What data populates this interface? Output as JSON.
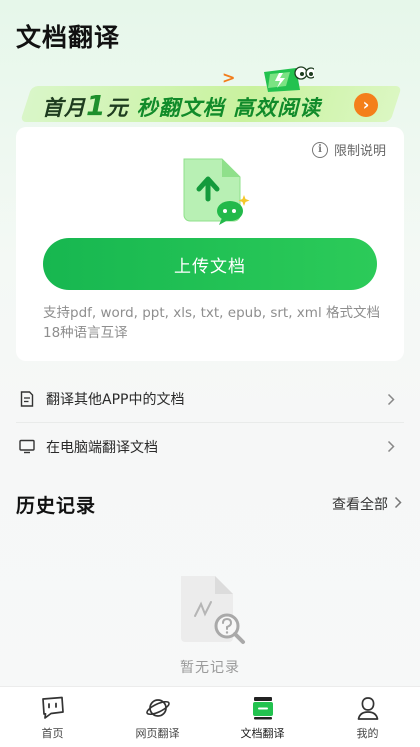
{
  "header": {
    "title": "文档翻译"
  },
  "banner": {
    "part1": "首月",
    "highlight_number": "1",
    "part2": "元",
    "part3": "秒翻文档",
    "part4": "高效阅读",
    "arrow": "›",
    "spark": ">"
  },
  "upload_card": {
    "limit_label": "限制说明",
    "info_glyph": "i",
    "upload_button_label": "上传文档",
    "support_text": "支持pdf, word, ppt, xls, txt, epub, srt, xml 格式文档 18种语言互译"
  },
  "options": [
    {
      "label": "翻译其他APP中的文档",
      "icon": "document-icon"
    },
    {
      "label": "在电脑端翻译文档",
      "icon": "monitor-icon"
    }
  ],
  "history": {
    "title": "历史记录",
    "view_all_label": "查看全部",
    "empty_text": "暂无记录"
  },
  "bottom_nav": {
    "items": [
      {
        "label": "首页",
        "icon": "home-chat-icon",
        "active": false
      },
      {
        "label": "网页翻译",
        "icon": "planet-icon",
        "active": false
      },
      {
        "label": "文档翻译",
        "icon": "doc-translate-icon",
        "active": true
      },
      {
        "label": "我的",
        "icon": "user-icon",
        "active": false
      }
    ]
  },
  "colors": {
    "accent": "#1fbf55",
    "banner_arrow": "#f47f1a",
    "text_secondary": "#8e8e8e"
  }
}
